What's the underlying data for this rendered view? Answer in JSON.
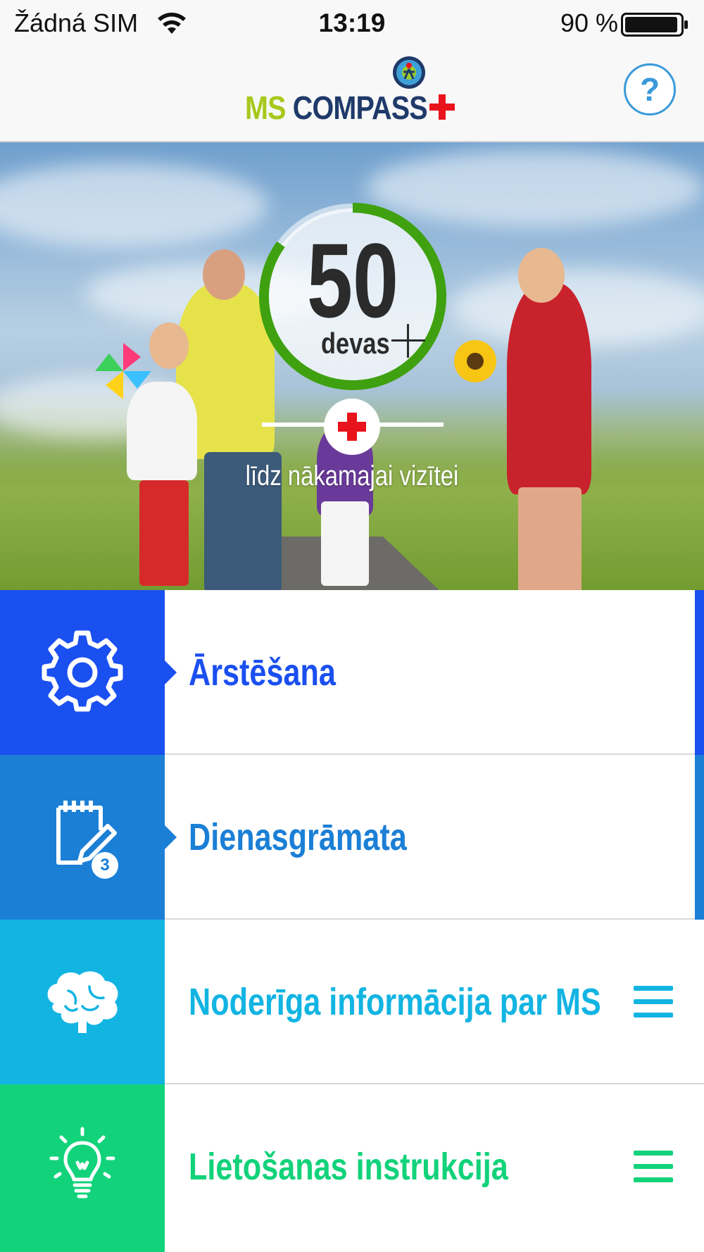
{
  "status_bar": {
    "carrier": "Žádná SIM",
    "time": "13:19",
    "battery_percent": "90 %"
  },
  "header": {
    "logo_ms": "MS",
    "logo_compass": "COMPASS",
    "help_label": "?"
  },
  "hero": {
    "count": "50",
    "count_unit": "devas",
    "visit_text": "līdz nākamajai vizītei",
    "progress": 0.85
  },
  "menu": {
    "items": [
      {
        "label": "Ārstēšana",
        "icon": "gear-icon",
        "color": "#1a4ff0"
      },
      {
        "label": "Dienasgrāmata",
        "icon": "notepad-icon",
        "color": "#1b7fd6",
        "badge": "3"
      },
      {
        "label": "Noderīga informācija par MS",
        "icon": "brain-icon",
        "color": "#12b4e2"
      },
      {
        "label": "Lietošanas instrukcija",
        "icon": "lightbulb-icon",
        "color": "#12d27a"
      }
    ]
  },
  "colors": {
    "progress_ring": "#3fa10f",
    "help": "#3a9ad9",
    "cross": "#e8131b"
  }
}
